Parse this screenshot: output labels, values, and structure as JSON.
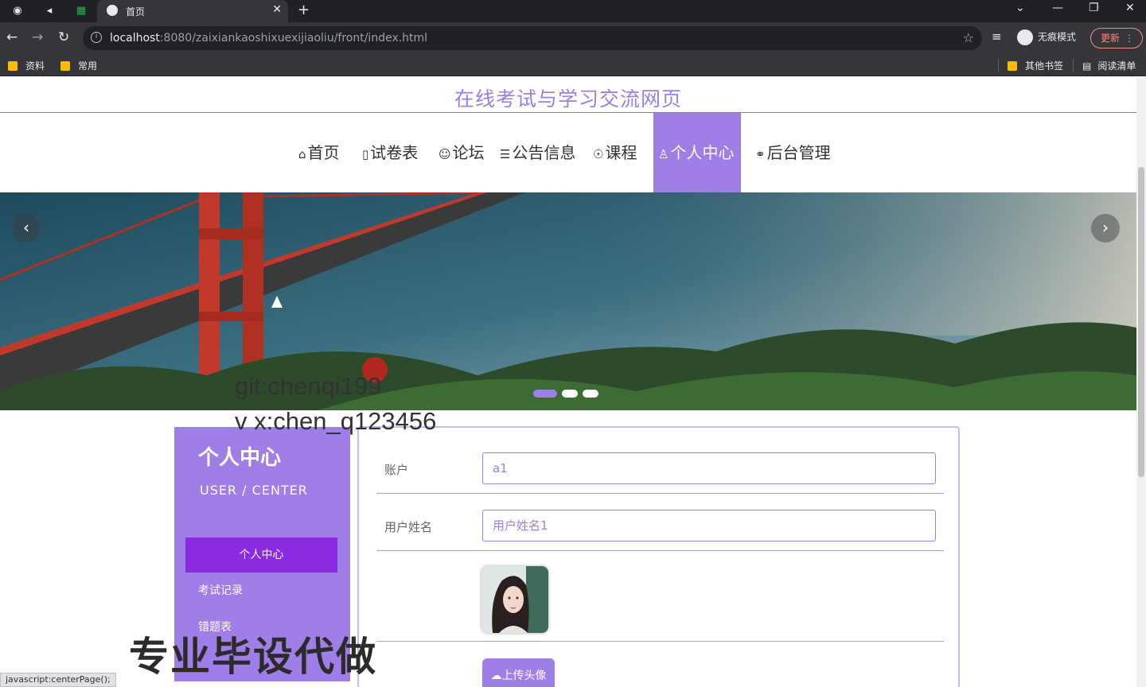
{
  "browser": {
    "tab_title": "首页",
    "url_host": "localhost",
    "url_rest": ":8080/zaixiankaoshixuexijiaoliu/front/index.html",
    "incognito_label": "无痕模式",
    "update_label": "更新",
    "bookmarks": [
      "资料",
      "常用"
    ],
    "bookmarks_right": [
      "其他书签",
      "阅读清单"
    ]
  },
  "site": {
    "title": "在线考试与学习交流网页",
    "menu": [
      {
        "icon": "⌂",
        "label": "首页"
      },
      {
        "icon": "▯",
        "label": "试卷表"
      },
      {
        "icon": "☺",
        "label": "论坛"
      },
      {
        "icon": "☰",
        "label": "公告信息"
      },
      {
        "icon": "☉",
        "label": "课程"
      },
      {
        "icon": "♙",
        "label": "个人中心"
      },
      {
        "icon": "⚭",
        "label": "后台管理"
      }
    ],
    "active_menu": "个人中心"
  },
  "carousel": {
    "slide_count": 3,
    "active_index": 0,
    "prev_glyph": "‹",
    "next_glyph": "›"
  },
  "watermarks": {
    "line1": "git:chenqi199",
    "line2": "v x:chen_q123456",
    "line3": "专业毕设代做"
  },
  "sidebar": {
    "title": "个人中心",
    "subtitle": "USER / CENTER",
    "items": [
      {
        "label": "个人中心",
        "active": true
      },
      {
        "label": "考试记录",
        "active": false
      },
      {
        "label": "错题表",
        "active": false
      }
    ]
  },
  "form": {
    "account_label": "账户",
    "account_value": "a1",
    "username_label": "用户姓名",
    "username_value": "用户姓名1",
    "upload_label": "上传头像"
  },
  "status_bar_text": "javascript:centerPage();",
  "colors": {
    "accent": "#a07ee8",
    "active_item": "#8a2be2",
    "title": "#9b7fe6"
  }
}
